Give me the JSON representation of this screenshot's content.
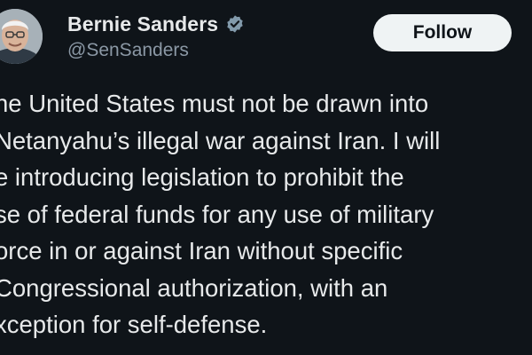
{
  "author": {
    "display_name": "Bernie Sanders",
    "handle": "@SenSanders",
    "verified_icon": "verified-badge-icon",
    "avatar": "profile-photo"
  },
  "actions": {
    "follow_label": "Follow"
  },
  "tweet": {
    "lines": [
      "he United States must not be drawn into",
      "Netanyahu’s illegal war against Iran. I will",
      "e introducing legislation to prohibit the",
      "se of federal funds for any use of military",
      "orce in or against Iran without specific",
      "Congressional authorization, with an",
      "xception for self-defense."
    ]
  },
  "colors": {
    "background": "#0f1419",
    "text": "#e7e9ea",
    "secondary_text": "#8b98a5",
    "follow_button_bg": "#eff3f4",
    "verified_badge": "#829aab"
  }
}
